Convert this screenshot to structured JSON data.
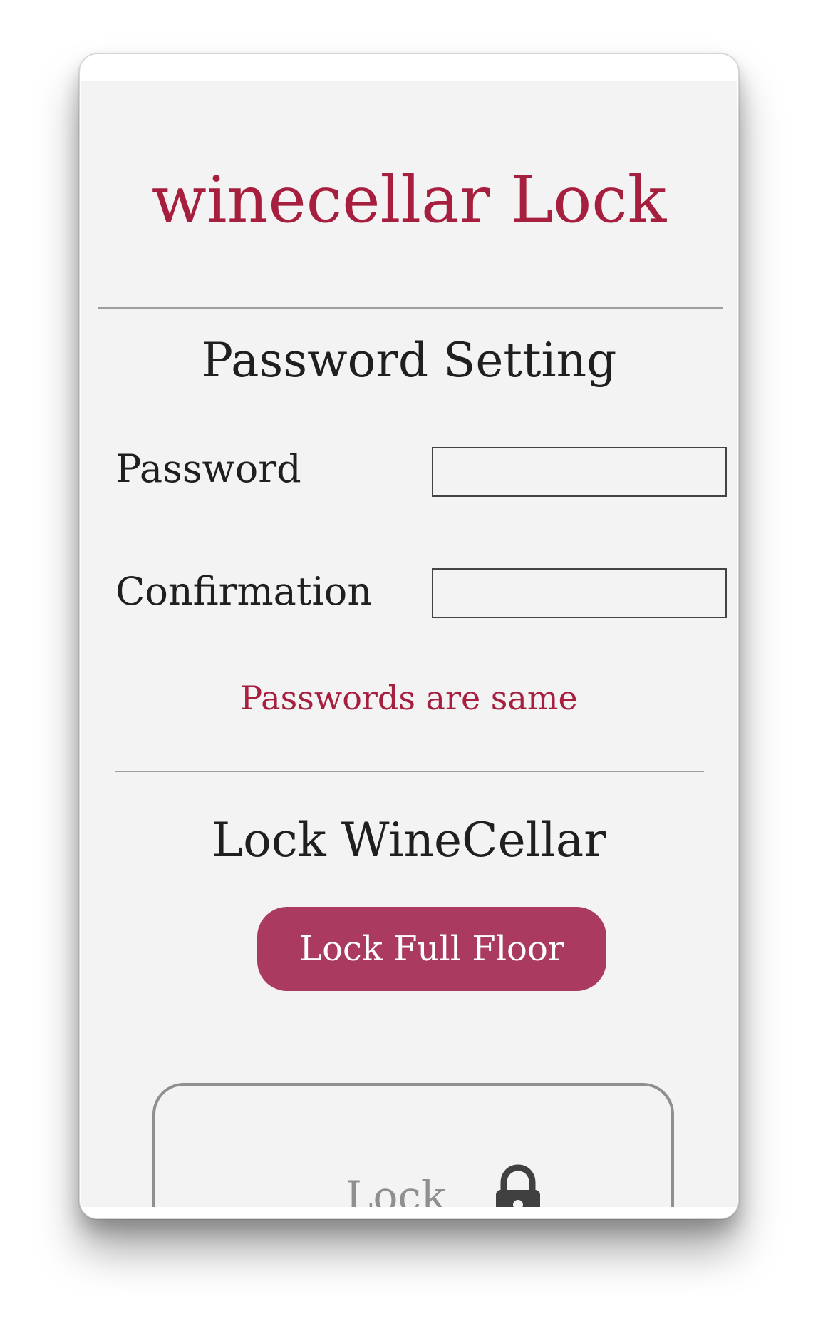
{
  "app": {
    "title": "winecellar Lock"
  },
  "password_setting": {
    "heading": "Password Setting",
    "password_label": "Password",
    "confirmation_label": "Confirmation",
    "password_value": "",
    "confirmation_value": "",
    "status_message": "Passwords are same"
  },
  "lock_winecellar": {
    "heading": "Lock WineCellar",
    "lock_full_floor_label": "Lock Full Floor",
    "lock_label": "Lock"
  },
  "colors": {
    "title": "#a61f3e",
    "status": "#a61f3e",
    "button_background": "#ab3a60",
    "background": "#f3f3f3",
    "text": "#1f1f1f",
    "muted": "#8f8f8f"
  },
  "icons": {
    "lock": "padlock-icon"
  }
}
